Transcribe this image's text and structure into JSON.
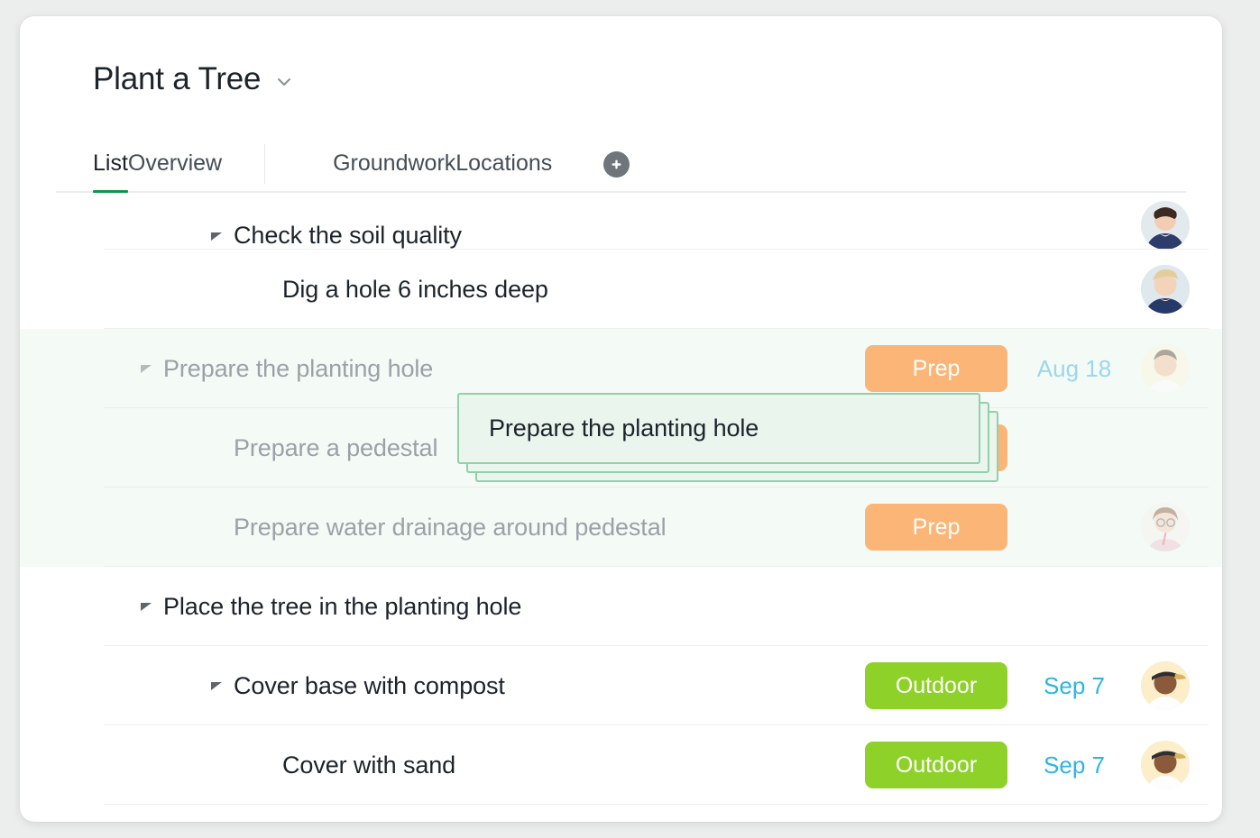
{
  "header": {
    "project_title": "Plant a Tree",
    "chevron_icon": "chevron-down-icon"
  },
  "tabs": [
    {
      "label": "List",
      "active": true
    },
    {
      "label": "Overview",
      "active": false
    },
    {
      "label": "Groundwork",
      "active": false
    },
    {
      "label": "Locations",
      "active": false
    }
  ],
  "add_tab": {
    "icon": "plus-icon",
    "label": "+"
  },
  "colors": {
    "page_background": "#eceded",
    "card_background": "#ffffff",
    "active_tab_underline": "#0b9948",
    "badge_prep": "#fbb577",
    "badge_outdoor": "#8ed129",
    "due_date_text": "#2ab5e6",
    "drag_card_border": "#93cfa9",
    "drag_card_fill": "#eaf5ee",
    "drag_row_background": "#f4faf6",
    "row_divider": "#eeeff0",
    "task_text": "#1d232b",
    "dimmed_task_text": "#9ba1a6"
  },
  "tasks": [
    {
      "name": "Check the soil quality",
      "indent": 2,
      "has_disclosure": true,
      "badge": "",
      "badge_style": "",
      "due": "",
      "avatar": "avatar-woman-dark-hair",
      "dragging": false,
      "clipped": true
    },
    {
      "name": "Dig a hole 6 inches deep",
      "indent": 3,
      "has_disclosure": false,
      "badge": "",
      "badge_style": "",
      "due": "",
      "avatar": "avatar-woman-blonde",
      "dragging": false,
      "clipped": false
    },
    {
      "name": "Prepare the planting hole",
      "indent": 1,
      "has_disclosure": true,
      "badge": "Prep",
      "badge_style": "orange",
      "due": "Aug 18",
      "avatar": "avatar-man-smiling",
      "dragging": true,
      "clipped": false
    },
    {
      "name": "Prepare a pedestal",
      "indent": 2,
      "has_disclosure": false,
      "badge": "Prep",
      "badge_style": "orange",
      "due": "",
      "avatar": "",
      "dragging": true,
      "clipped": false
    },
    {
      "name": "Prepare water drainage around pedestal",
      "indent": 2,
      "has_disclosure": false,
      "badge": "Prep",
      "badge_style": "orange",
      "due": "",
      "avatar": "avatar-woman-glasses",
      "dragging": true,
      "clipped": false
    },
    {
      "name": "Place the tree in the planting hole",
      "indent": 1,
      "has_disclosure": true,
      "badge": "",
      "badge_style": "",
      "due": "",
      "avatar": "",
      "dragging": false,
      "clipped": false
    },
    {
      "name": "Cover base with compost",
      "indent": 2,
      "has_disclosure": true,
      "badge": "Outdoor",
      "badge_style": "green",
      "due": "Sep 7",
      "avatar": "avatar-man-cap",
      "dragging": false,
      "clipped": false
    },
    {
      "name": "Cover with sand",
      "indent": 3,
      "has_disclosure": false,
      "badge": "Outdoor",
      "badge_style": "green",
      "due": "Sep 7",
      "avatar": "avatar-man-cap",
      "dragging": false,
      "clipped": false
    }
  ],
  "drag_ghost": {
    "label": "Prepare the planting hole",
    "card_count": 3
  }
}
